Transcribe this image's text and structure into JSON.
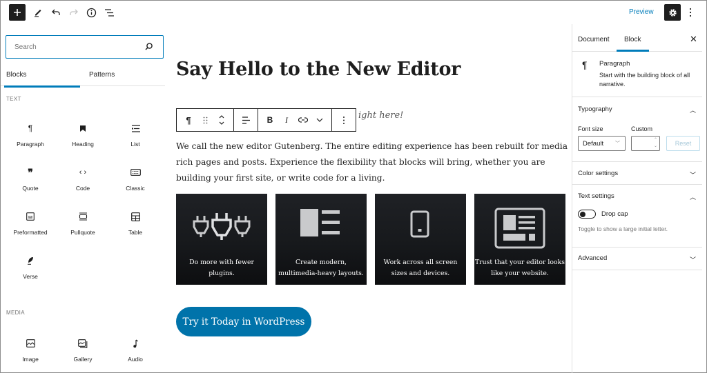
{
  "topbar": {
    "add_icon": "plus-icon",
    "tools_icon": "pencil-icon",
    "undo_icon": "undo-icon",
    "redo_icon": "redo-icon",
    "info_icon": "info-icon",
    "outline_icon": "list-view-icon",
    "preview_label": "Preview",
    "settings_icon": "gear-icon",
    "more_icon": "more-vertical-icon"
  },
  "inserter": {
    "search_placeholder": "Search",
    "tabs": [
      {
        "label": "Blocks",
        "active": true
      },
      {
        "label": "Patterns",
        "active": false
      }
    ],
    "categories": [
      {
        "label": "TEXT",
        "blocks": [
          {
            "label": "Paragraph",
            "icon": "paragraph-icon"
          },
          {
            "label": "Heading",
            "icon": "heading-icon"
          },
          {
            "label": "List",
            "icon": "list-icon"
          },
          {
            "label": "Quote",
            "icon": "quote-icon"
          },
          {
            "label": "Code",
            "icon": "code-icon"
          },
          {
            "label": "Classic",
            "icon": "keyboard-icon"
          },
          {
            "label": "Preformatted",
            "icon": "preformatted-icon"
          },
          {
            "label": "Pullquote",
            "icon": "pullquote-icon"
          },
          {
            "label": "Table",
            "icon": "table-icon"
          },
          {
            "label": "Verse",
            "icon": "feather-icon"
          }
        ]
      },
      {
        "label": "MEDIA",
        "blocks": [
          {
            "label": "Image",
            "icon": "image-icon"
          },
          {
            "label": "Gallery",
            "icon": "gallery-icon"
          },
          {
            "label": "Audio",
            "icon": "audio-icon"
          }
        ]
      }
    ]
  },
  "canvas": {
    "title": "Say Hello to the New Editor",
    "hidden_line_fragment": "ight here!",
    "paragraph": "We call the new editor Gutenberg. The entire editing experience has been rebuilt for media rich pages and posts. Experience the flexibility that blocks will bring, whether you are building your first site, or write code for a living.",
    "cards": [
      {
        "text": "Do more with fewer plugins.",
        "icon": "plugs-icon"
      },
      {
        "text": "Create modern, multimedia-heavy layouts.",
        "icon": "layout-icon"
      },
      {
        "text": "Work across all screen sizes and devices.",
        "icon": "mobile-icon"
      },
      {
        "text": "Trust that your editor looks like your website.",
        "icon": "website-icon"
      }
    ],
    "cta_label": "Try it Today in WordPress"
  },
  "block_toolbar": {
    "items": [
      "paragraph-icon",
      "drag-handle-icon",
      "move-up-down-icon",
      "align-left-icon",
      "bold-icon",
      "italic-icon",
      "link-icon",
      "chevron-down-icon",
      "more-vertical-icon"
    ]
  },
  "sidebar": {
    "tabs": [
      {
        "label": "Document",
        "active": false
      },
      {
        "label": "Block",
        "active": true
      }
    ],
    "close_icon": "close-icon",
    "block_name": "Paragraph",
    "block_desc": "Start with the building block of all narrative.",
    "typography": {
      "title": "Typography",
      "font_size_label": "Font size",
      "font_size_value": "Default",
      "custom_label": "Custom",
      "custom_value": "",
      "reset_label": "Reset"
    },
    "color_settings": "Color settings",
    "text_settings": {
      "title": "Text settings",
      "drop_cap_label": "Drop cap",
      "drop_cap_on": false,
      "help": "Toggle to show a large initial letter."
    },
    "advanced": "Advanced"
  }
}
